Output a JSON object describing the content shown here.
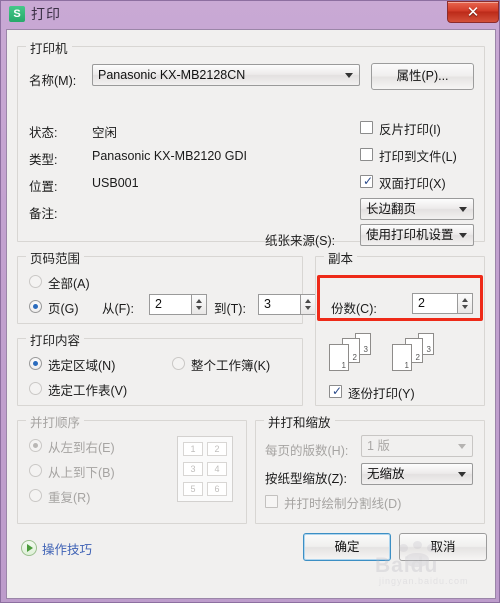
{
  "window": {
    "title": "打印",
    "app_icon": "S",
    "close_icon": "close-icon",
    "close_glyph": "✕"
  },
  "printer": {
    "group_label": "打印机",
    "name_label": "名称(M):",
    "name_value": "Panasonic KX-MB2128CN",
    "properties_button": "属性(P)...",
    "status_label": "状态:",
    "status_value": "空闲",
    "type_label": "类型:",
    "type_value": "Panasonic KX-MB2120 GDI",
    "location_label": "位置:",
    "location_value": "USB001",
    "comment_label": "备注:",
    "checkboxes": [
      {
        "label": "反片打印(I)",
        "checked": false
      },
      {
        "label": "打印到文件(L)",
        "checked": false
      },
      {
        "label": "双面打印(X)",
        "checked": true
      }
    ],
    "duplex_value": "长边翻页",
    "paper_source_label": "纸张来源(S):",
    "paper_source_value": "使用打印机设置"
  },
  "page_range": {
    "group_label": "页码范围",
    "all_label": "全部(A)",
    "all_selected": false,
    "pages_label": "页(G)",
    "pages_selected": true,
    "from_label": "从(F):",
    "from_value": "2",
    "to_label": "到(T):",
    "to_value": "3"
  },
  "copies": {
    "group_label": "副本",
    "count_label": "份数(C):",
    "count_value": "2",
    "collate_label": "逐份打印(Y)",
    "collate_checked": true,
    "preview_pages": [
      "1",
      "2",
      "3"
    ],
    "highlight_color": "#ee2a18"
  },
  "print_content": {
    "group_label": "打印内容",
    "options": [
      {
        "label": "选定区域(N)",
        "selected": true
      },
      {
        "label": "整个工作簿(K)",
        "selected": false
      },
      {
        "label": "选定工作表(V)",
        "selected": false
      }
    ]
  },
  "merge_order": {
    "group_label": "并打顺序",
    "disabled": true,
    "options": [
      {
        "label": "从左到右(E)",
        "selected": true
      },
      {
        "label": "从上到下(B)",
        "selected": false
      },
      {
        "label": "重复(R)",
        "selected": false
      }
    ],
    "preview_cells": [
      "1",
      "2",
      "3",
      "4",
      "5",
      "6"
    ]
  },
  "merge_scale": {
    "group_label": "并打和缩放",
    "pages_per_sheet_label": "每页的版数(H):",
    "pages_per_sheet_value": "1 版",
    "pages_per_sheet_disabled": true,
    "scale_label": "按纸型缩放(Z):",
    "scale_value": "无缩放",
    "divider_label": "并打时绘制分割线(D)",
    "divider_checked": false,
    "divider_disabled": true
  },
  "footer": {
    "tips_label": "操作技巧",
    "tips_icon": "play-circle-icon",
    "ok_button": "确定",
    "cancel_button": "取消"
  },
  "watermark": {
    "text": "Baidu",
    "subtext": "jingyan.baidu.com"
  }
}
